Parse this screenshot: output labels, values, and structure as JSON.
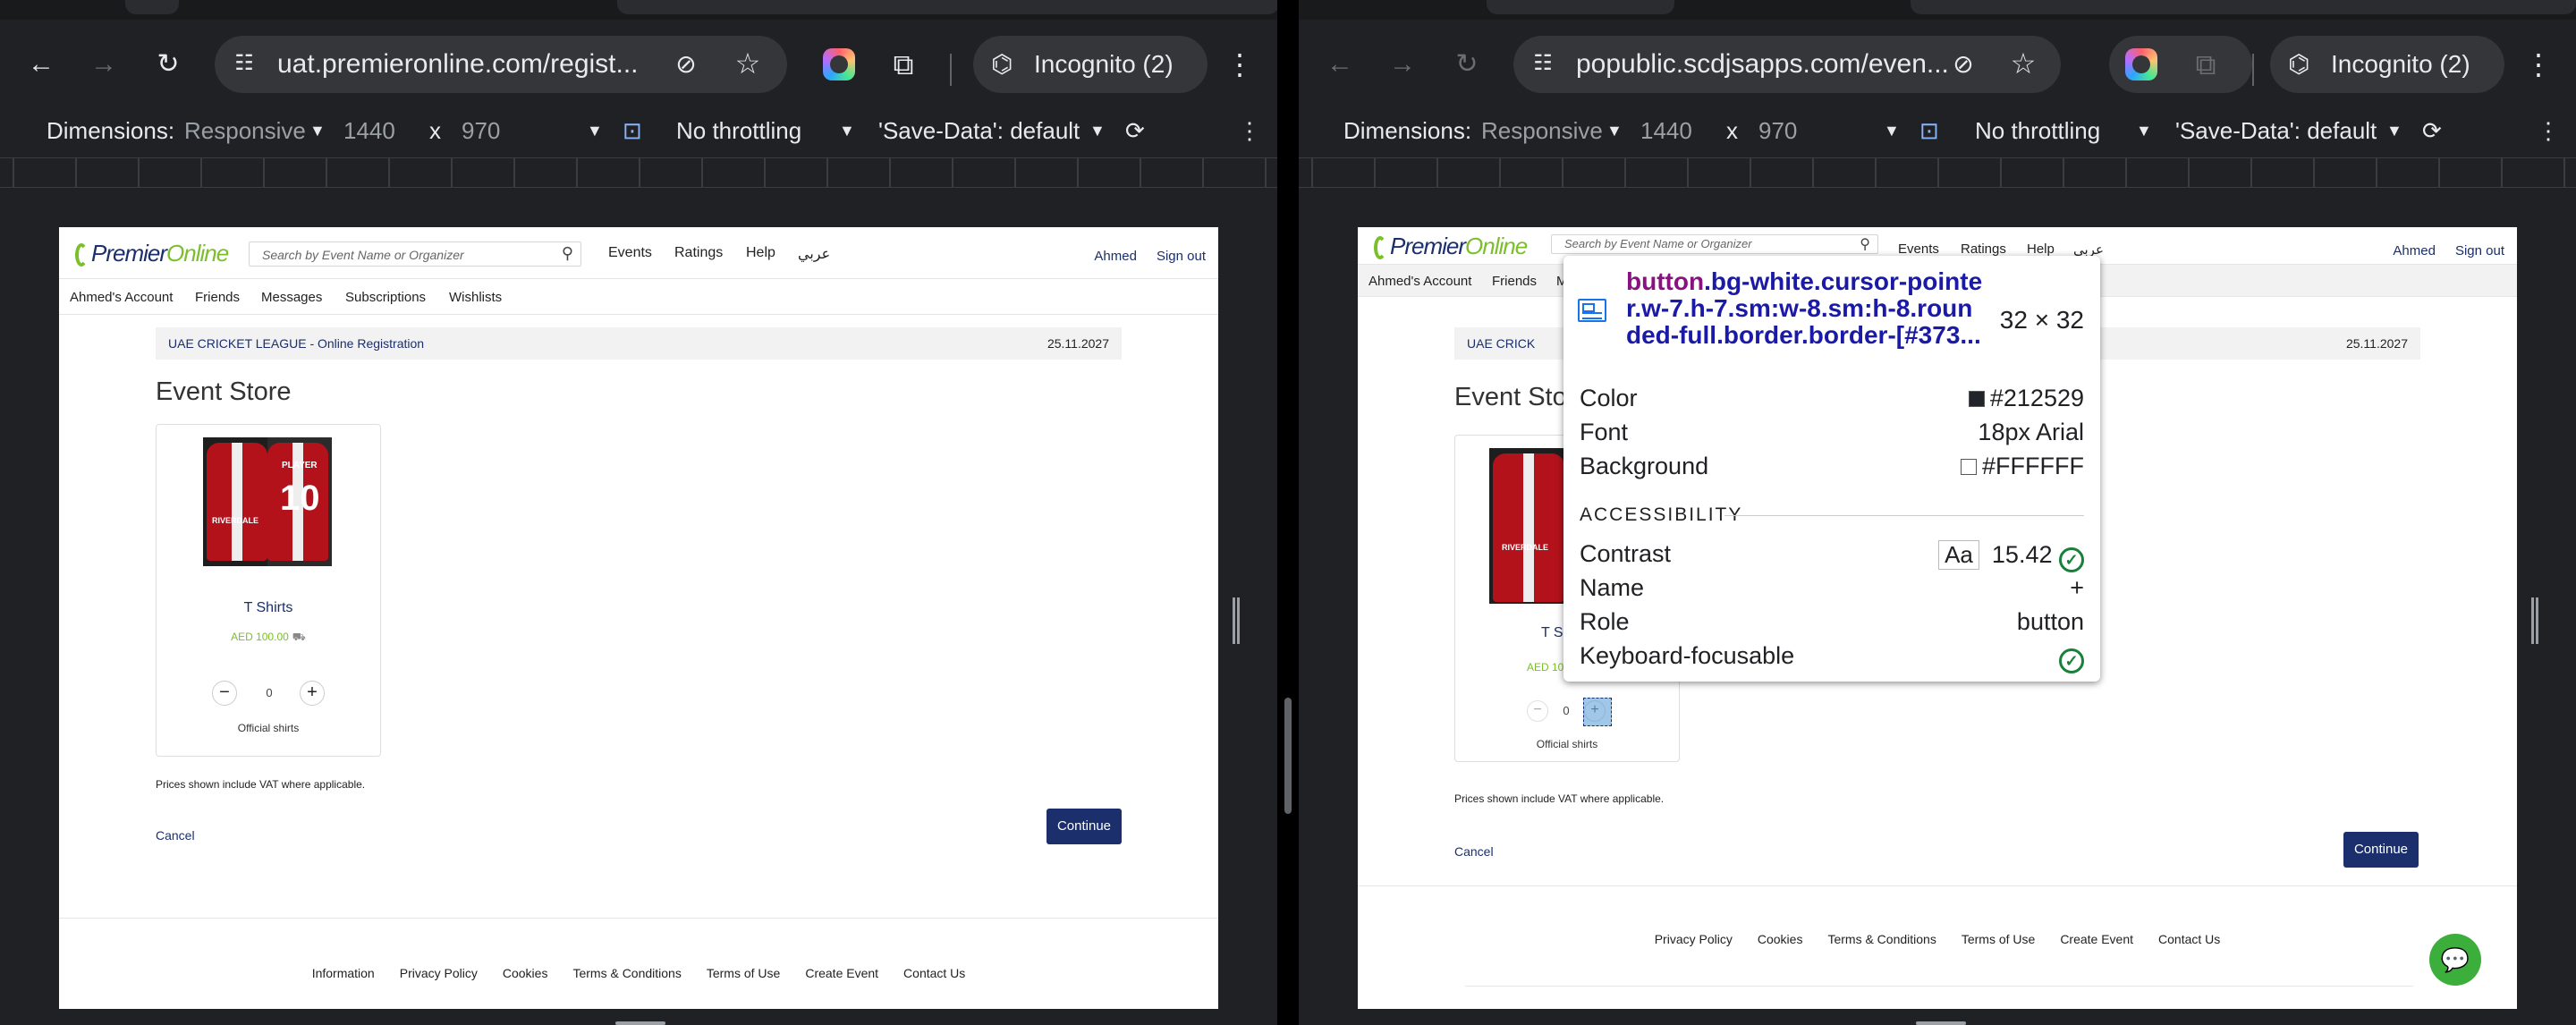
{
  "left": {
    "url": "uat.premieronline.com/regist...",
    "incognito": "Incognito (2)",
    "devbar": {
      "dimensions_label": "Dimensions:",
      "mode": "Responsive",
      "width": "1440",
      "x": "x",
      "height": "970",
      "throttle": "No throttling",
      "savedata": "'Save-Data': default"
    },
    "site": {
      "logo_a": "Premier",
      "logo_b": "Online",
      "search_placeholder": "Search by Event Name or Organizer",
      "menu": [
        "Events",
        "Ratings",
        "Help",
        "عربي"
      ],
      "user": "Ahmed",
      "signout": "Sign out",
      "subnav": [
        "Ahmed's Account",
        "Friends",
        "Messages",
        "Subscriptions",
        "Wishlists"
      ],
      "crumb_left": "UAE CRICKET LEAGUE - Online Registration",
      "crumb_right": "25.11.2027",
      "title": "Event Store",
      "product": {
        "name": "T Shirts",
        "price": "AED 100.00",
        "qty": "0",
        "minus": "−",
        "plus": "+",
        "desc": "Official shirts",
        "shirt_number": "10",
        "shirt_player": "PLAYER",
        "shirt_team": "RIVERDALE"
      },
      "vat": "Prices shown include VAT where applicable.",
      "cancel": "Cancel",
      "continue": "Continue",
      "footer": [
        "Information",
        "Privacy Policy",
        "Cookies",
        "Terms & Conditions",
        "Terms of Use",
        "Create Event",
        "Contact Us"
      ]
    }
  },
  "right": {
    "url": "popublic.scdjsapps.com/even...",
    "incognito": "Incognito (2)",
    "devbar": {
      "dimensions_label": "Dimensions:",
      "mode": "Responsive",
      "width": "1440",
      "x": "x",
      "height": "970",
      "throttle": "No throttling",
      "savedata": "'Save-Data': default"
    },
    "site": {
      "logo_a": "Premier",
      "logo_b": "Online",
      "search_placeholder": "Search by Event Name or Organizer",
      "menu": [
        "Events",
        "Ratings",
        "Help",
        "عربي"
      ],
      "user": "Ahmed",
      "signout": "Sign out",
      "subnav": [
        "Ahmed's Account",
        "Friends",
        "M"
      ],
      "crumb_left": "UAE CRICK",
      "crumb_right": "25.11.2027",
      "title": "Event Sto",
      "product": {
        "name": "T Sh",
        "price": "AED 10",
        "qty": "0",
        "minus": "−",
        "plus": "+",
        "desc": "Official shirts",
        "shirt_team": "RIVERDALE"
      },
      "vat": "Prices shown include VAT where applicable.",
      "cancel": "Cancel",
      "continue": "Continue",
      "footer": [
        "Privacy Policy",
        "Cookies",
        "Terms & Conditions",
        "Terms of Use",
        "Create Event",
        "Contact Us"
      ]
    },
    "inspector": {
      "selector_tag": "button",
      "selector_classes": ".bg-white.cursor-pointer.w-7.h-7.sm:w-8.sm:h-8.rounded-full.border.border-[#373...",
      "size": "32 × 32",
      "color_label": "Color",
      "color_value": "#212529",
      "font_label": "Font",
      "font_value": "18px Arial",
      "bg_label": "Background",
      "bg_value": "#FFFFFF",
      "accessibility": "ACCESSIBILITY",
      "contrast_label": "Contrast",
      "contrast_aa": "Aa",
      "contrast_value": "15.42",
      "name_label": "Name",
      "name_value": "+",
      "role_label": "Role",
      "role_value": "button",
      "kf_label": "Keyboard-focusable"
    }
  },
  "colors": {
    "brand_navy": "#1a2f6b",
    "brand_green": "#7bbf2a",
    "chrome_bg": "#202124",
    "omnibox": "#35363a"
  }
}
